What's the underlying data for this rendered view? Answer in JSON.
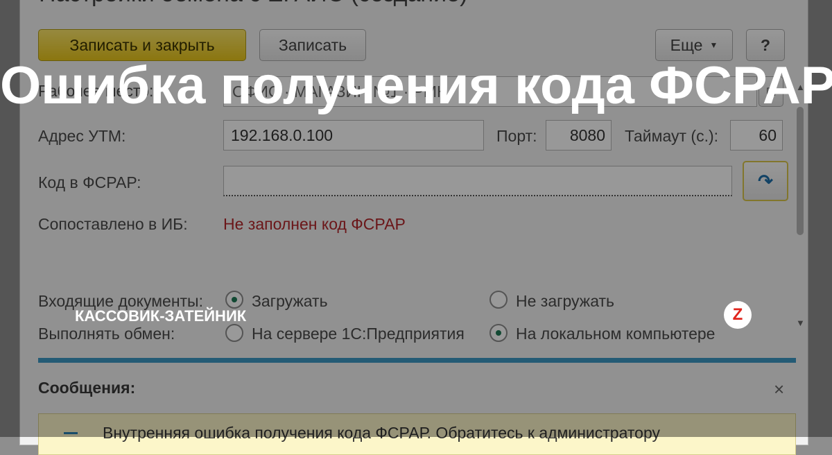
{
  "window": {
    "title": "Настройки обмена с ЕГАИС (создание)"
  },
  "toolbar": {
    "save_close_label": "Записать и закрыть",
    "save_label": "Записать",
    "more_label": "Еще",
    "more_icon": "dropdown-caret-icon",
    "help_label": "?"
  },
  "form": {
    "workplace_label": "Рабочее место:",
    "workplace_value": "ОФИС · МАГАЗИН №1 · РМК",
    "open_icon": "open-window-icon",
    "utm_label": "Адрес УТМ:",
    "utm_value": "192.168.0.100",
    "port_label": "Порт:",
    "port_value": "8080",
    "timeout_label": "Таймаут (с.):",
    "timeout_value": "60",
    "fsrar_label": "Код в ФСРАР:",
    "fsrar_value": "",
    "fetch_icon": "fetch-arrow-icon",
    "matched_label": "Сопоставлено в ИБ:",
    "matched_value": "Не заполнен код ФСРАР",
    "incoming_label": "Входящие документы:",
    "incoming_opt1": "Загружать",
    "incoming_opt2": "Не загружать",
    "exchange_label": "Выполнять обмен:",
    "exchange_opt1": "На сервере 1С:Предприятия",
    "exchange_opt2": "На локальном компьютере"
  },
  "messages": {
    "title": "Сообщения:",
    "close_label": "×",
    "text": "Внутренняя ошибка получения кода ФСРАР. Обратитесь к администратору"
  },
  "overlay": {
    "headline": "Ошибка получения кода ФСРАР",
    "brand": "КАССОВИК-ЗАТЕЙНИК",
    "zen_logo": "Z"
  },
  "colors": {
    "accent": "#3d98c4",
    "error_text": "#b3262a",
    "primary_button": "#f2d531"
  }
}
